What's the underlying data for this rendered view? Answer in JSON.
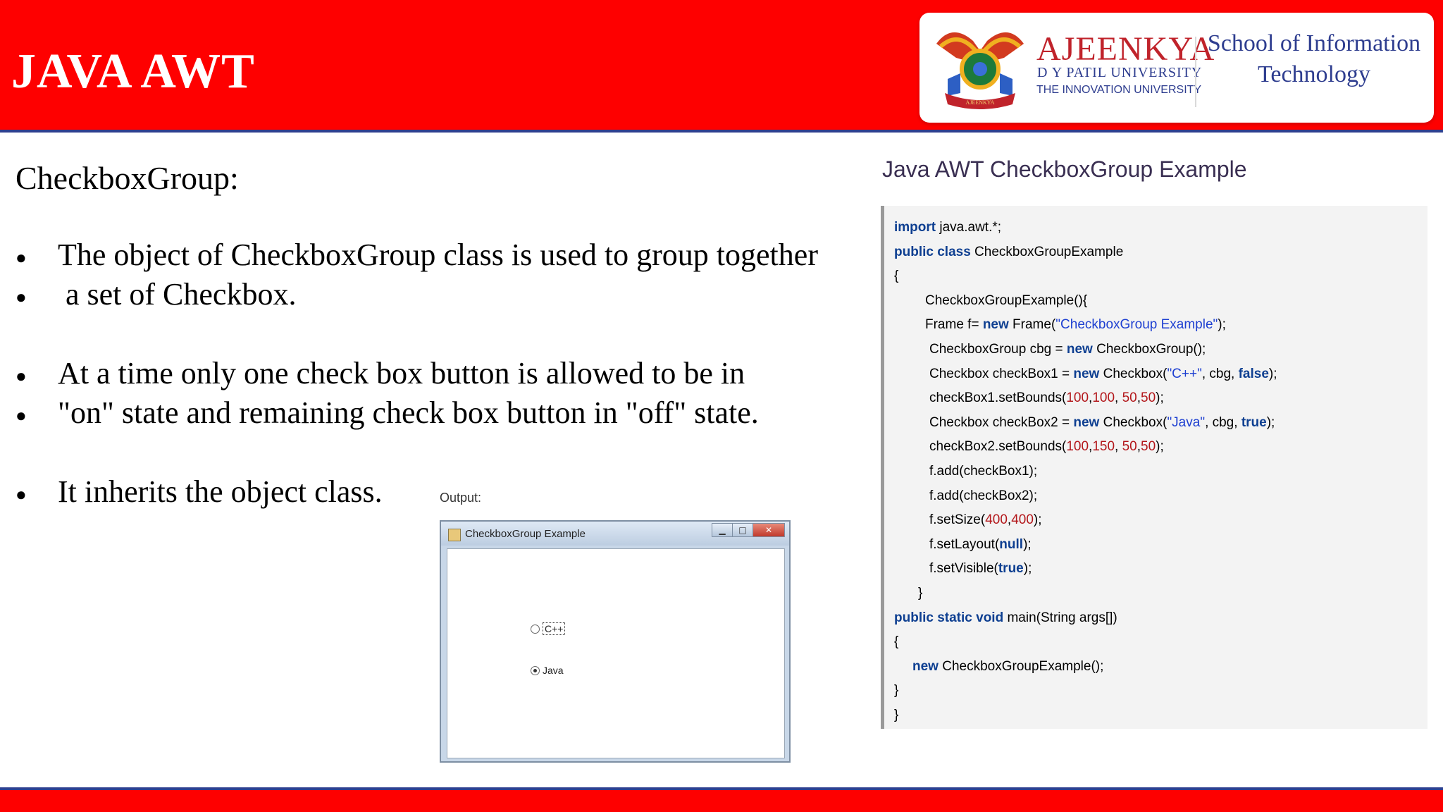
{
  "header": {
    "title": "JAVA AWT",
    "logo": {
      "university_name": "AJEENKYA",
      "university_subtitle": "D Y PATIL UNIVERSITY",
      "tagline": "THE INNOVATION UNIVERSITY",
      "crest_text": "AJEENKYA",
      "school_name": "School of Information Technology"
    }
  },
  "slide": {
    "heading": "CheckboxGroup:",
    "bullets": [
      "The object of CheckboxGroup class is used to group together",
      " a set of Checkbox.",
      "At a time only one check box button is allowed to be in",
      "\"on\" state and remaining check box button in \"off\" state.",
      "It inherits the object class."
    ]
  },
  "output": {
    "label": "Output:",
    "window_title": "CheckboxGroup Example",
    "radio_options": [
      {
        "label": "C++",
        "selected": false
      },
      {
        "label": "Java",
        "selected": true
      }
    ]
  },
  "code": {
    "title": "Java AWT CheckboxGroup Example",
    "lines": [
      [
        {
          "t": "import",
          "c": "kw"
        },
        {
          "t": " java.awt.*;"
        }
      ],
      [
        {
          "t": "public class",
          "c": "kw"
        },
        {
          "t": " CheckboxGroupExample"
        }
      ],
      [
        {
          "t": "{"
        }
      ],
      [
        {
          "t": "CheckboxGroupExample(){"
        }
      ],
      [
        {
          "t": "Frame f= "
        },
        {
          "t": "new",
          "c": "kw"
        },
        {
          "t": " Frame("
        },
        {
          "t": "\"CheckboxGroup Example\"",
          "c": "str"
        },
        {
          "t": ");"
        }
      ],
      [
        {
          "t": "CheckboxGroup cbg = "
        },
        {
          "t": "new",
          "c": "kw"
        },
        {
          "t": " CheckboxGroup();"
        }
      ],
      [
        {
          "t": "Checkbox checkBox1 = "
        },
        {
          "t": "new",
          "c": "kw"
        },
        {
          "t": " Checkbox("
        },
        {
          "t": "\"C++\"",
          "c": "str"
        },
        {
          "t": ", cbg, "
        },
        {
          "t": "false",
          "c": "kw"
        },
        {
          "t": ");"
        }
      ],
      [
        {
          "t": "checkBox1.setBounds("
        },
        {
          "t": "100",
          "c": "num"
        },
        {
          "t": ","
        },
        {
          "t": "100",
          "c": "num"
        },
        {
          "t": ", "
        },
        {
          "t": "50",
          "c": "num"
        },
        {
          "t": ","
        },
        {
          "t": "50",
          "c": "num"
        },
        {
          "t": ");"
        }
      ],
      [
        {
          "t": "Checkbox checkBox2 = "
        },
        {
          "t": "new",
          "c": "kw"
        },
        {
          "t": " Checkbox("
        },
        {
          "t": "\"Java\"",
          "c": "str"
        },
        {
          "t": ", cbg, "
        },
        {
          "t": "true",
          "c": "kw"
        },
        {
          "t": ");"
        }
      ],
      [
        {
          "t": "checkBox2.setBounds("
        },
        {
          "t": "100",
          "c": "num"
        },
        {
          "t": ","
        },
        {
          "t": "150",
          "c": "num"
        },
        {
          "t": ", "
        },
        {
          "t": "50",
          "c": "num"
        },
        {
          "t": ","
        },
        {
          "t": "50",
          "c": "num"
        },
        {
          "t": ");"
        }
      ],
      [
        {
          "t": "f.add(checkBox1);"
        }
      ],
      [
        {
          "t": "f.add(checkBox2);"
        }
      ],
      [
        {
          "t": "f.setSize("
        },
        {
          "t": "400",
          "c": "num"
        },
        {
          "t": ","
        },
        {
          "t": "400",
          "c": "num"
        },
        {
          "t": ");"
        }
      ],
      [
        {
          "t": "f.setLayout("
        },
        {
          "t": "null",
          "c": "kw"
        },
        {
          "t": ");"
        }
      ],
      [
        {
          "t": "f.setVisible("
        },
        {
          "t": "true",
          "c": "kw"
        },
        {
          "t": ");"
        }
      ],
      [
        {
          "t": "}"
        }
      ],
      [
        {
          "t": "public static void",
          "c": "kw"
        },
        {
          "t": " main(String args[])"
        }
      ],
      [
        {
          "t": "{"
        }
      ],
      [
        {
          "t": "new",
          "c": "kw"
        },
        {
          "t": " CheckboxGroupExample();"
        }
      ],
      [
        {
          "t": "}"
        }
      ],
      [
        {
          "t": "}"
        }
      ]
    ]
  },
  "colors": {
    "header_red": "#fe0000",
    "header_border_blue": "#2e3f8f",
    "keyword_blue": "#0e3f91",
    "string_blue": "#1d3fd1",
    "number_red": "#b3171b"
  }
}
